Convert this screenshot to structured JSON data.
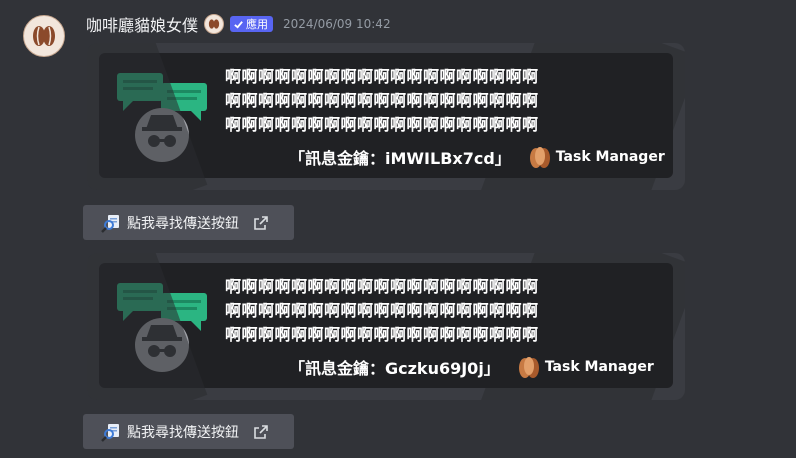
{
  "message": {
    "username": "咖啡廳貓娘女僕",
    "badge_label": "應用",
    "timestamp": "2024/06/09 10:42"
  },
  "embeds": [
    {
      "lines": [
        "啊啊啊啊啊啊啊啊啊啊啊啊啊啊啊啊啊啊啊",
        "啊啊啊啊啊啊啊啊啊啊啊啊啊啊啊啊啊啊啊",
        "啊啊啊啊啊啊啊啊啊啊啊啊啊啊啊啊啊啊啊"
      ],
      "key_text": "「訊息金鑰：iMWILBx7cd」",
      "brand": "Task Manager",
      "button_label": "點我尋找傳送按鈕"
    },
    {
      "lines": [
        "啊啊啊啊啊啊啊啊啊啊啊啊啊啊啊啊啊啊啊",
        "啊啊啊啊啊啊啊啊啊啊啊啊啊啊啊啊啊啊啊",
        "啊啊啊啊啊啊啊啊啊啊啊啊啊啊啊啊啊啊啊"
      ],
      "key_text": "「訊息金鑰：Gczku69J0j」",
      "brand": "Task Manager",
      "button_label": "點我尋找傳送按鈕"
    }
  ],
  "icons": {
    "avatar": "coffee-bean-icon",
    "embed_art": "incognito-chat-icon",
    "brand_logo": "task-manager-logo-icon",
    "button_search": "magnifier-document-icon",
    "button_external": "external-link-icon"
  },
  "colors": {
    "background": "#313338",
    "badge": "#5865f2",
    "button": "#4e5058",
    "chat_bubble": "#2bb582"
  }
}
